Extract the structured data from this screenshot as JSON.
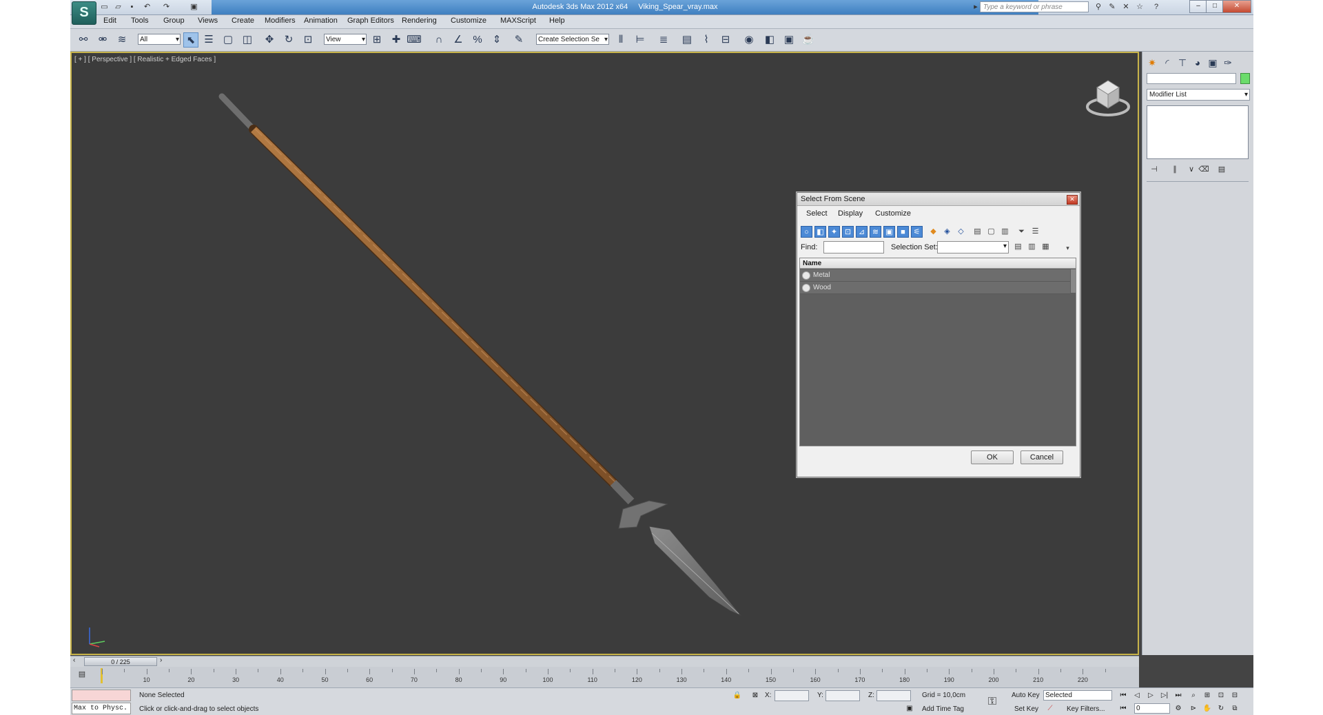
{
  "app": {
    "name": "Autodesk 3ds Max  2012 x64",
    "file": "Viking_Spear_vray.max",
    "logo": "S",
    "search_placeholder": "Type a keyword or phrase"
  },
  "menu": [
    "Edit",
    "Tools",
    "Group",
    "Views",
    "Create",
    "Modifiers",
    "Animation",
    "Graph Editors",
    "Rendering",
    "Customize",
    "MAXScript",
    "Help"
  ],
  "toolbar": {
    "filter": "All",
    "ref_coord": "View",
    "named_selection": "Create Selection Se"
  },
  "viewport": {
    "label": "[ + ] [ Perspective ] [ Realistic + Edged Faces ]"
  },
  "dialog": {
    "title": "Select From Scene",
    "menu": [
      "Select",
      "Display",
      "Customize"
    ],
    "find_label": "Find:",
    "selection_set_label": "Selection Set:",
    "column_name": "Name",
    "rows": [
      "Metal",
      "Wood"
    ],
    "ok": "OK",
    "cancel": "Cancel"
  },
  "command_panel": {
    "modifier_list": "Modifier List",
    "object_color": "#6bdc6b"
  },
  "timeline": {
    "slider": "0 / 225",
    "ticks": [
      10,
      20,
      30,
      40,
      50,
      60,
      70,
      80,
      90,
      100,
      110,
      120,
      130,
      140,
      150,
      160,
      170,
      180,
      190,
      200,
      210,
      220
    ]
  },
  "status": {
    "listener": "Max to Physc.",
    "selection": "None Selected",
    "prompt": "Click or click-and-drag to select objects",
    "x_label": "X:",
    "y_label": "Y:",
    "z_label": "Z:",
    "grid": "Grid = 10,0cm",
    "add_time_tag": "Add Time Tag",
    "auto_key": "Auto Key",
    "set_key": "Set Key",
    "key_mode": "Selected",
    "key_filters": "Key Filters...",
    "frame": "0"
  }
}
